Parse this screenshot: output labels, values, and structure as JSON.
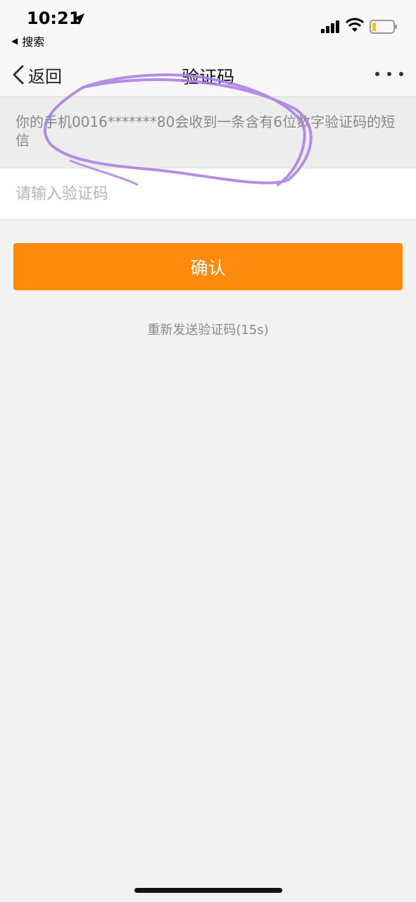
{
  "status_bar": {
    "time": "10:21",
    "back_to_app": "搜索",
    "icons": [
      "location-arrow-icon",
      "cellular-signal-icon",
      "wifi-icon",
      "battery-icon"
    ]
  },
  "nav": {
    "back_label": "返回",
    "title": "验证码",
    "more_icon": "more-dots-icon"
  },
  "info": {
    "text": "你的手机0016*******80会收到一条含有6位数字验证码的短信"
  },
  "input": {
    "value": "",
    "placeholder": "请输入验证码"
  },
  "confirm_label": "确认",
  "resend_label": "重新发送验证码(15s)",
  "colors": {
    "accent": "#ff8a0c",
    "annotation": "#a77be0",
    "background": "#f2f2f2"
  }
}
